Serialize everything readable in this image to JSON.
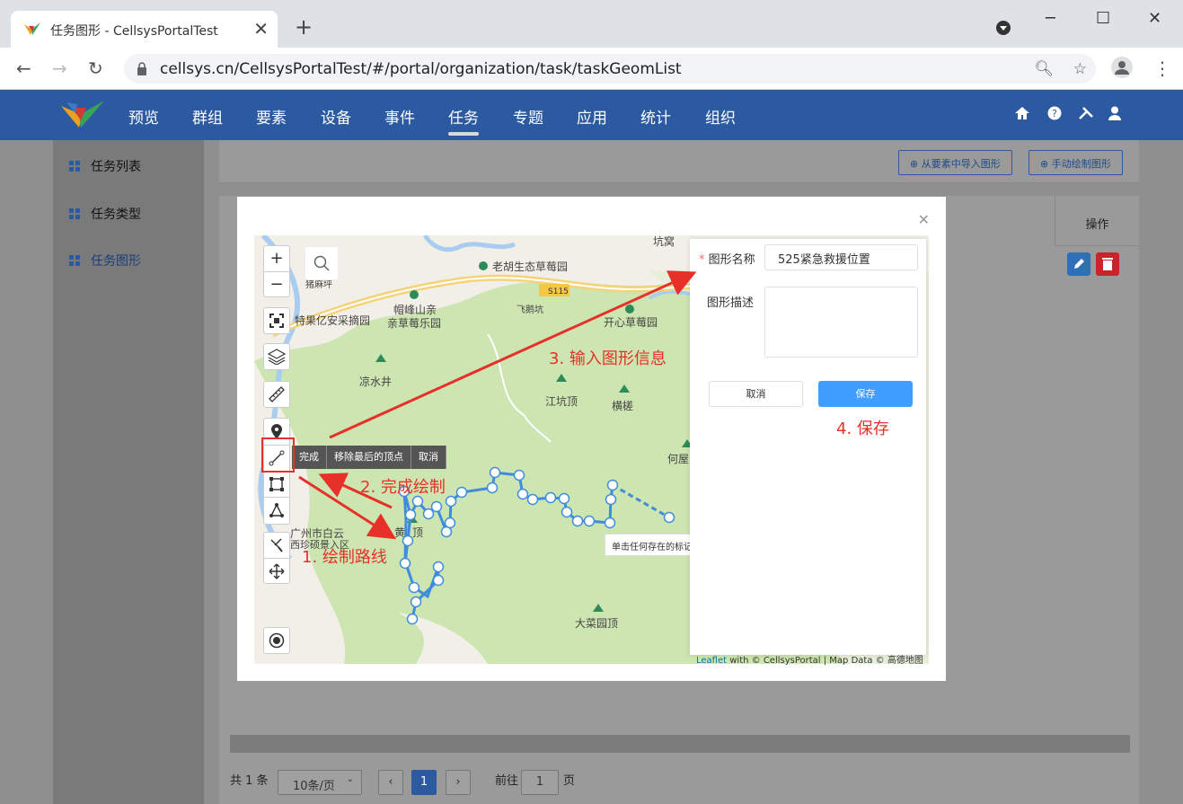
{
  "browser": {
    "tab_title": "任务图形 - CellsysPortalTest",
    "url": "cellsys.cn/CellsysPortalTest/#/portal/organization/task/taskGeomList"
  },
  "app": {
    "menu": [
      "预览",
      "群组",
      "要素",
      "设备",
      "事件",
      "任务",
      "专题",
      "应用",
      "统计",
      "组织"
    ],
    "active_menu": "任务"
  },
  "sidebar": {
    "items": [
      {
        "label": "任务列表"
      },
      {
        "label": "任务类型"
      },
      {
        "label": "任务图形",
        "active": true
      }
    ]
  },
  "toolbar": {
    "import_label": "从要素中导入图形",
    "draw_label": "手动绘制图形"
  },
  "table": {
    "op_header": "操作"
  },
  "pagination": {
    "total": "共 1 条",
    "page_size": "10条/页",
    "current_page": "1",
    "goto_label": "前往",
    "goto_value": "1",
    "page_unit": "页"
  },
  "map": {
    "draw_actions": [
      "完成",
      "移除最后的顶点",
      "取消"
    ],
    "tooltip": "单击任何存在的标记以完成",
    "attribution_link": "Leaflet",
    "attribution_text": " with © CellsysPortal | Map Data © 高德地图",
    "road_label": "S115",
    "pois": [
      {
        "name": "坑窝"
      },
      {
        "name": "老胡生态草莓园"
      },
      {
        "name": "猪麻坪"
      },
      {
        "name": "帽峰山亲"
      },
      {
        "name": "亲草莓乐园"
      },
      {
        "name": "飞鹅坑"
      },
      {
        "name": "开心草莓园"
      },
      {
        "name": "特果亿安采摘园"
      },
      {
        "name": "凉水井"
      },
      {
        "name": "江坑顶"
      },
      {
        "name": "横槎"
      },
      {
        "name": "何屋"
      },
      {
        "name": "广州市白云"
      },
      {
        "name": "西珍硕景入区"
      },
      {
        "name": "黄"
      },
      {
        "name": "顶"
      },
      {
        "name": "大菜园顶"
      }
    ]
  },
  "form": {
    "name_label": "图形名称",
    "name_value": "525紧急救援位置",
    "desc_label": "图形描述",
    "desc_value": "",
    "cancel_label": "取消",
    "save_label": "保存"
  },
  "annotations": {
    "step1": "1. 绘制路线",
    "step2": "2. 完成绘制",
    "step3": "3. 输入图形信息",
    "step4": "4. 保存"
  },
  "colors": {
    "appbar": "#2b5aa0",
    "primary": "#409eff",
    "annotation": "#e8302a",
    "route": "#3e8ddd"
  }
}
